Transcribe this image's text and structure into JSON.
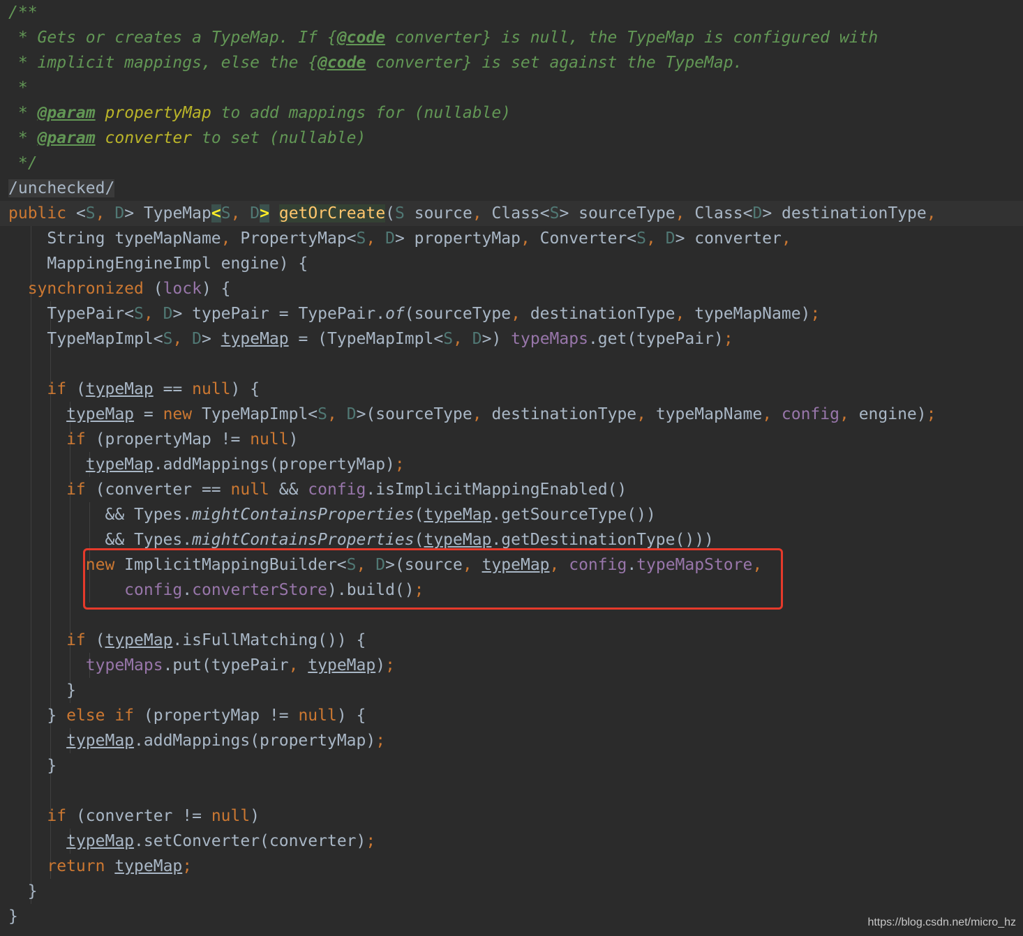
{
  "editor": {
    "language": "java",
    "theme_colors": {
      "background": "#2b2b2b",
      "plain": "#a9b7c6",
      "keyword": "#cc7832",
      "type_param": "#507874",
      "field": "#9876aa",
      "method_decl": "#ffc66d",
      "doc_comment": "#629755",
      "highlight_box": "#e53a2b"
    },
    "lines": [
      [
        [
          "doc",
          "/**"
        ]
      ],
      [
        [
          "doc",
          " * Gets or creates a TypeMap. If {"
        ],
        [
          "tag",
          "@code"
        ],
        [
          "doc",
          " converter} is null, the TypeMap is configured with"
        ]
      ],
      [
        [
          "doc",
          " * implicit mappings, else the {"
        ],
        [
          "tag",
          "@code"
        ],
        [
          "doc",
          " converter} is set against the TypeMap."
        ]
      ],
      [
        [
          "doc",
          " *"
        ]
      ],
      [
        [
          "doc",
          " * "
        ],
        [
          "tag",
          "@param"
        ],
        [
          "doc",
          " "
        ],
        [
          "ann",
          "propertyMap"
        ],
        [
          "doc",
          " to add mappings for (nullable)"
        ]
      ],
      [
        [
          "doc",
          " * "
        ],
        [
          "tag",
          "@param"
        ],
        [
          "doc",
          " "
        ],
        [
          "ann",
          "converter"
        ],
        [
          "doc",
          " to set (nullable)"
        ]
      ],
      [
        [
          "doc",
          " */"
        ]
      ],
      [
        [
          "lbl",
          "/unchecked/"
        ]
      ],
      [
        [
          "kw",
          "public "
        ],
        [
          "plain",
          "<"
        ],
        [
          "tp",
          "S"
        ],
        [
          "kw",
          ", "
        ],
        [
          "tp",
          "D"
        ],
        [
          "plain",
          "> TypeMap"
        ],
        [
          "brace",
          "<"
        ],
        [
          "tp",
          "S"
        ],
        [
          "kw",
          ", "
        ],
        [
          "tp",
          "D"
        ],
        [
          "brace",
          ">"
        ],
        [
          "plain",
          " "
        ],
        [
          "fnhl",
          "getOrCreate"
        ],
        [
          "plain",
          "("
        ],
        [
          "tp",
          "S"
        ],
        [
          "plain",
          " source"
        ],
        [
          "kw",
          ", "
        ],
        [
          "plain",
          "Class<"
        ],
        [
          "tp",
          "S"
        ],
        [
          "plain",
          "> sourceType"
        ],
        [
          "kw",
          ", "
        ],
        [
          "plain",
          "Class<"
        ],
        [
          "tp",
          "D"
        ],
        [
          "plain",
          "> destinationType"
        ],
        [
          "kw",
          ","
        ]
      ],
      [
        [
          "plain",
          "    String typeMapName"
        ],
        [
          "kw",
          ", "
        ],
        [
          "plain",
          "PropertyMap<"
        ],
        [
          "tp",
          "S"
        ],
        [
          "kw",
          ", "
        ],
        [
          "tp",
          "D"
        ],
        [
          "plain",
          "> propertyMap"
        ],
        [
          "kw",
          ", "
        ],
        [
          "plain",
          "Converter<"
        ],
        [
          "tp",
          "S"
        ],
        [
          "kw",
          ", "
        ],
        [
          "tp",
          "D"
        ],
        [
          "plain",
          "> converter"
        ],
        [
          "kw",
          ","
        ]
      ],
      [
        [
          "plain",
          "    MappingEngineImpl engine) {"
        ]
      ],
      [
        [
          "kw",
          "  synchronized "
        ],
        [
          "plain",
          "("
        ],
        [
          "fld",
          "lock"
        ],
        [
          "plain",
          ") {"
        ]
      ],
      [
        [
          "plain",
          "    TypePair<"
        ],
        [
          "tp",
          "S"
        ],
        [
          "kw",
          ", "
        ],
        [
          "tp",
          "D"
        ],
        [
          "plain",
          "> typePair = TypePair."
        ],
        [
          "italic",
          "of"
        ],
        [
          "plain",
          "(sourceType"
        ],
        [
          "kw",
          ", "
        ],
        [
          "plain",
          "destinationType"
        ],
        [
          "kw",
          ", "
        ],
        [
          "plain",
          "typeMapName)"
        ],
        [
          "kw",
          ";"
        ]
      ],
      [
        [
          "plain",
          "    TypeMapImpl<"
        ],
        [
          "tp",
          "S"
        ],
        [
          "kw",
          ", "
        ],
        [
          "tp",
          "D"
        ],
        [
          "plain",
          "> "
        ],
        [
          "var",
          "typeMap"
        ],
        [
          "plain",
          " = (TypeMapImpl<"
        ],
        [
          "tp",
          "S"
        ],
        [
          "kw",
          ", "
        ],
        [
          "tp",
          "D"
        ],
        [
          "plain",
          ">) "
        ],
        [
          "fld",
          "typeMaps"
        ],
        [
          "plain",
          ".get(typePair)"
        ],
        [
          "kw",
          ";"
        ]
      ],
      [],
      [
        [
          "kw",
          "    if "
        ],
        [
          "plain",
          "("
        ],
        [
          "var",
          "typeMap"
        ],
        [
          "plain",
          " == "
        ],
        [
          "kw",
          "null"
        ],
        [
          "plain",
          ") {"
        ]
      ],
      [
        [
          "plain",
          "      "
        ],
        [
          "var",
          "typeMap"
        ],
        [
          "plain",
          " = "
        ],
        [
          "kw",
          "new "
        ],
        [
          "plain",
          "TypeMapImpl<"
        ],
        [
          "tp",
          "S"
        ],
        [
          "kw",
          ", "
        ],
        [
          "tp",
          "D"
        ],
        [
          "plain",
          ">(sourceType"
        ],
        [
          "kw",
          ", "
        ],
        [
          "plain",
          "destinationType"
        ],
        [
          "kw",
          ", "
        ],
        [
          "plain",
          "typeMapName"
        ],
        [
          "kw",
          ", "
        ],
        [
          "fld",
          "config"
        ],
        [
          "kw",
          ", "
        ],
        [
          "plain",
          "engine)"
        ],
        [
          "kw",
          ";"
        ]
      ],
      [
        [
          "kw",
          "      if "
        ],
        [
          "plain",
          "(propertyMap != "
        ],
        [
          "kw",
          "null"
        ],
        [
          "plain",
          ")"
        ]
      ],
      [
        [
          "plain",
          "        "
        ],
        [
          "var",
          "typeMap"
        ],
        [
          "plain",
          ".addMappings(propertyMap)"
        ],
        [
          "kw",
          ";"
        ]
      ],
      [
        [
          "kw",
          "      if "
        ],
        [
          "plain",
          "(converter == "
        ],
        [
          "kw",
          "null "
        ],
        [
          "plain",
          "&& "
        ],
        [
          "fld",
          "config"
        ],
        [
          "plain",
          ".isImplicitMappingEnabled()"
        ]
      ],
      [
        [
          "plain",
          "          && Types."
        ],
        [
          "italic",
          "mightContainsProperties"
        ],
        [
          "plain",
          "("
        ],
        [
          "var",
          "typeMap"
        ],
        [
          "plain",
          ".getSourceType())"
        ]
      ],
      [
        [
          "plain",
          "          && Types."
        ],
        [
          "italic",
          "mightContainsProperties"
        ],
        [
          "plain",
          "("
        ],
        [
          "var",
          "typeMap"
        ],
        [
          "plain",
          ".getDestinationType()))"
        ]
      ],
      [
        [
          "kw",
          "        new "
        ],
        [
          "plain",
          "ImplicitMappingBuilder<"
        ],
        [
          "tp",
          "S"
        ],
        [
          "kw",
          ", "
        ],
        [
          "tp",
          "D"
        ],
        [
          "plain",
          ">(source"
        ],
        [
          "kw",
          ", "
        ],
        [
          "var",
          "typeMap"
        ],
        [
          "kw",
          ", "
        ],
        [
          "fld",
          "config"
        ],
        [
          "plain",
          "."
        ],
        [
          "fld",
          "typeMapStore"
        ],
        [
          "kw",
          ","
        ]
      ],
      [
        [
          "plain",
          "            "
        ],
        [
          "fld",
          "config"
        ],
        [
          "plain",
          "."
        ],
        [
          "fld",
          "converterStore"
        ],
        [
          "plain",
          ").build()"
        ],
        [
          "kw",
          ";"
        ]
      ],
      [],
      [
        [
          "kw",
          "      if "
        ],
        [
          "plain",
          "("
        ],
        [
          "var",
          "typeMap"
        ],
        [
          "plain",
          ".isFullMatching()) {"
        ]
      ],
      [
        [
          "plain",
          "        "
        ],
        [
          "fld",
          "typeMaps"
        ],
        [
          "plain",
          ".put(typePair"
        ],
        [
          "kw",
          ", "
        ],
        [
          "var",
          "typeMap"
        ],
        [
          "plain",
          ")"
        ],
        [
          "kw",
          ";"
        ]
      ],
      [
        [
          "plain",
          "      }"
        ]
      ],
      [
        [
          "plain",
          "    } "
        ],
        [
          "kw",
          "else if "
        ],
        [
          "plain",
          "(propertyMap != "
        ],
        [
          "kw",
          "null"
        ],
        [
          "plain",
          ") {"
        ]
      ],
      [
        [
          "plain",
          "      "
        ],
        [
          "var",
          "typeMap"
        ],
        [
          "plain",
          ".addMappings(propertyMap)"
        ],
        [
          "kw",
          ";"
        ]
      ],
      [
        [
          "plain",
          "    }"
        ]
      ],
      [],
      [
        [
          "kw",
          "    if "
        ],
        [
          "plain",
          "(converter != "
        ],
        [
          "kw",
          "null"
        ],
        [
          "plain",
          ")"
        ]
      ],
      [
        [
          "plain",
          "      "
        ],
        [
          "var",
          "typeMap"
        ],
        [
          "plain",
          ".setConverter(converter)"
        ],
        [
          "kw",
          ";"
        ]
      ],
      [
        [
          "kw",
          "    return "
        ],
        [
          "var",
          "typeMap"
        ],
        [
          "kw",
          ";"
        ]
      ],
      [
        [
          "plain",
          "  }"
        ]
      ],
      [
        [
          "plain",
          "}"
        ]
      ]
    ],
    "guides": [
      [],
      [],
      [],
      [],
      [],
      [],
      [],
      [],
      [],
      [
        1
      ],
      [
        1
      ],
      [
        1
      ],
      [
        1,
        2
      ],
      [
        1,
        2
      ],
      [
        1,
        2
      ],
      [
        1,
        2
      ],
      [
        1,
        2,
        3
      ],
      [
        1,
        2,
        3
      ],
      [
        1,
        2,
        3,
        4
      ],
      [
        1,
        2,
        3
      ],
      [
        1,
        2,
        3,
        4
      ],
      [
        1,
        2,
        3,
        4
      ],
      [
        1,
        2,
        3,
        4
      ],
      [
        1,
        2,
        3,
        4
      ],
      [
        1,
        2,
        3
      ],
      [
        1,
        2,
        3
      ],
      [
        1,
        2,
        3,
        4
      ],
      [
        1,
        2,
        3
      ],
      [
        1,
        2
      ],
      [
        1,
        2,
        3
      ],
      [
        1,
        2
      ],
      [
        1,
        2
      ],
      [
        1,
        2
      ],
      [
        1,
        2,
        3
      ],
      [
        1,
        2
      ],
      [
        1
      ],
      []
    ]
  },
  "watermark": "https://blog.csdn.net/micro_hz"
}
